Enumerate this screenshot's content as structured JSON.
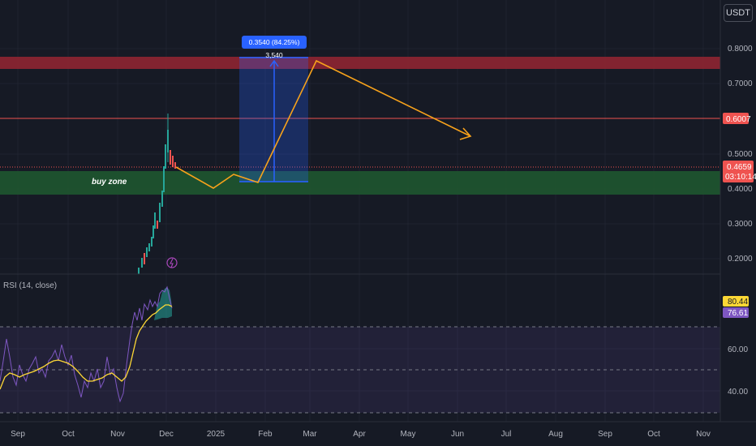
{
  "currency_button": "USDT",
  "price_axis": {
    "ticks": [
      "0.8000",
      "0.7000",
      "0.5000",
      "0.4000",
      "0.3000",
      "0.2000"
    ]
  },
  "rsi_axis": {
    "ticks": [
      "60.00",
      "40.00"
    ]
  },
  "time_axis": {
    "ticks": [
      "Sep",
      "Oct",
      "Nov",
      "Dec",
      "2025",
      "Feb",
      "Mar",
      "Apr",
      "May",
      "Jun",
      "Jul",
      "Aug",
      "Sep",
      "Oct",
      "Nov"
    ]
  },
  "resistance_tag": {
    "value": "0.6007"
  },
  "current_price_tag": {
    "price": "0.4659",
    "countdown": "03:10:14"
  },
  "rsi": {
    "title": "RSI (14, close)",
    "value": "80.44",
    "ma_value": "76.61"
  },
  "zones": {
    "buy_zone": "buy zone"
  },
  "measure_tool": {
    "label": "0.3540 (84.25%) 3,540"
  },
  "colors": {
    "background": "#161a25",
    "resistance_zone": "#8e2532",
    "buy_zone": "#1e5630",
    "up_candle": "#26a69a",
    "down_candle": "#ef5350",
    "projection": "#f7a21b",
    "measure": "#2962ff",
    "rsi_line": "#7e57c2",
    "rsi_ma": "#fdd835"
  },
  "icons": {
    "flash": "lightning-icon"
  }
}
